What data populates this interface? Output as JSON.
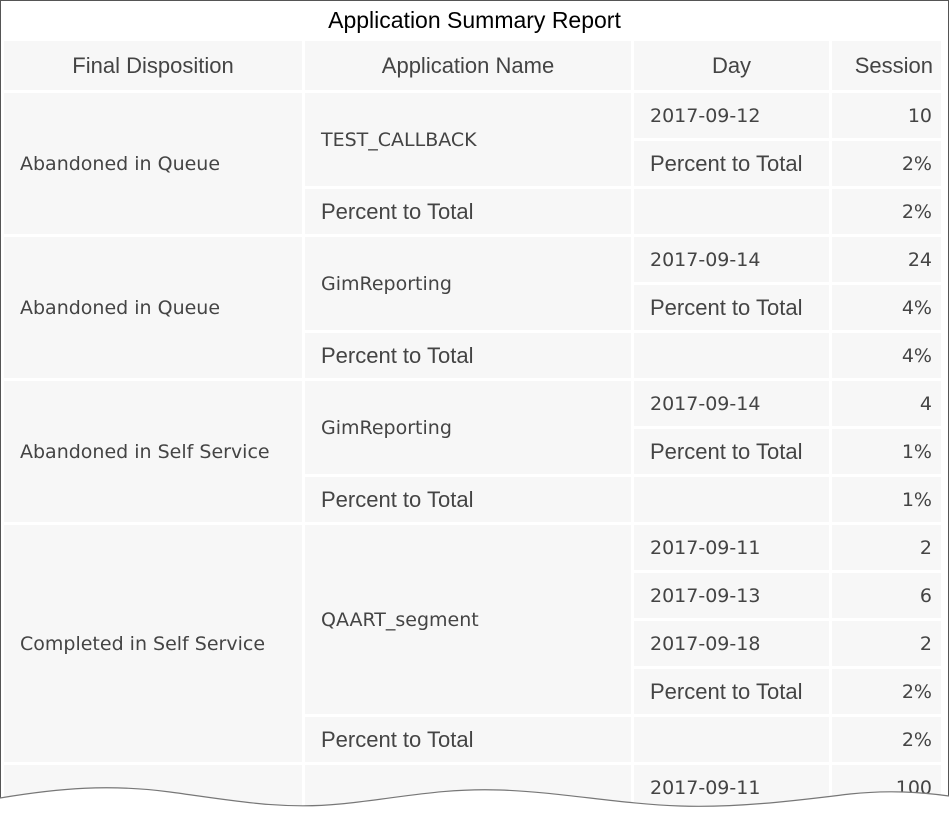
{
  "report": {
    "title": "Application Summary Report",
    "headers": {
      "disposition": "Final Disposition",
      "app": "Application Name",
      "day": "Day",
      "session": "Session"
    },
    "groups": [
      {
        "disposition": "Abandoned in Queue",
        "app": "TEST_CALLBACK",
        "days": [
          {
            "day": "2017-09-12",
            "session": "10"
          }
        ],
        "app_pct_label": "Percent to Total",
        "app_pct": "2%",
        "group_pct_label": "Percent to Total",
        "group_pct": "2%"
      },
      {
        "disposition": "Abandoned in Queue",
        "app": "GimReporting",
        "days": [
          {
            "day": "2017-09-14",
            "session": "24"
          }
        ],
        "app_pct_label": "Percent to Total",
        "app_pct": "4%",
        "group_pct_label": "Percent to Total",
        "group_pct": "4%"
      },
      {
        "disposition": "Abandoned in Self Service",
        "app": "GimReporting",
        "days": [
          {
            "day": "2017-09-14",
            "session": "4"
          }
        ],
        "app_pct_label": "Percent to Total",
        "app_pct": "1%",
        "group_pct_label": "Percent to Total",
        "group_pct": "1%"
      },
      {
        "disposition": "Completed in Self Service",
        "app": "QAART_segment",
        "days": [
          {
            "day": "2017-09-11",
            "session": "2"
          },
          {
            "day": "2017-09-13",
            "session": "6"
          },
          {
            "day": "2017-09-18",
            "session": "2"
          }
        ],
        "app_pct_label": "Percent to Total",
        "app_pct": "2%",
        "group_pct_label": "Percent to Total",
        "group_pct": "2%"
      }
    ],
    "partial_row": {
      "day": "2017-09-11",
      "session": "100"
    }
  }
}
